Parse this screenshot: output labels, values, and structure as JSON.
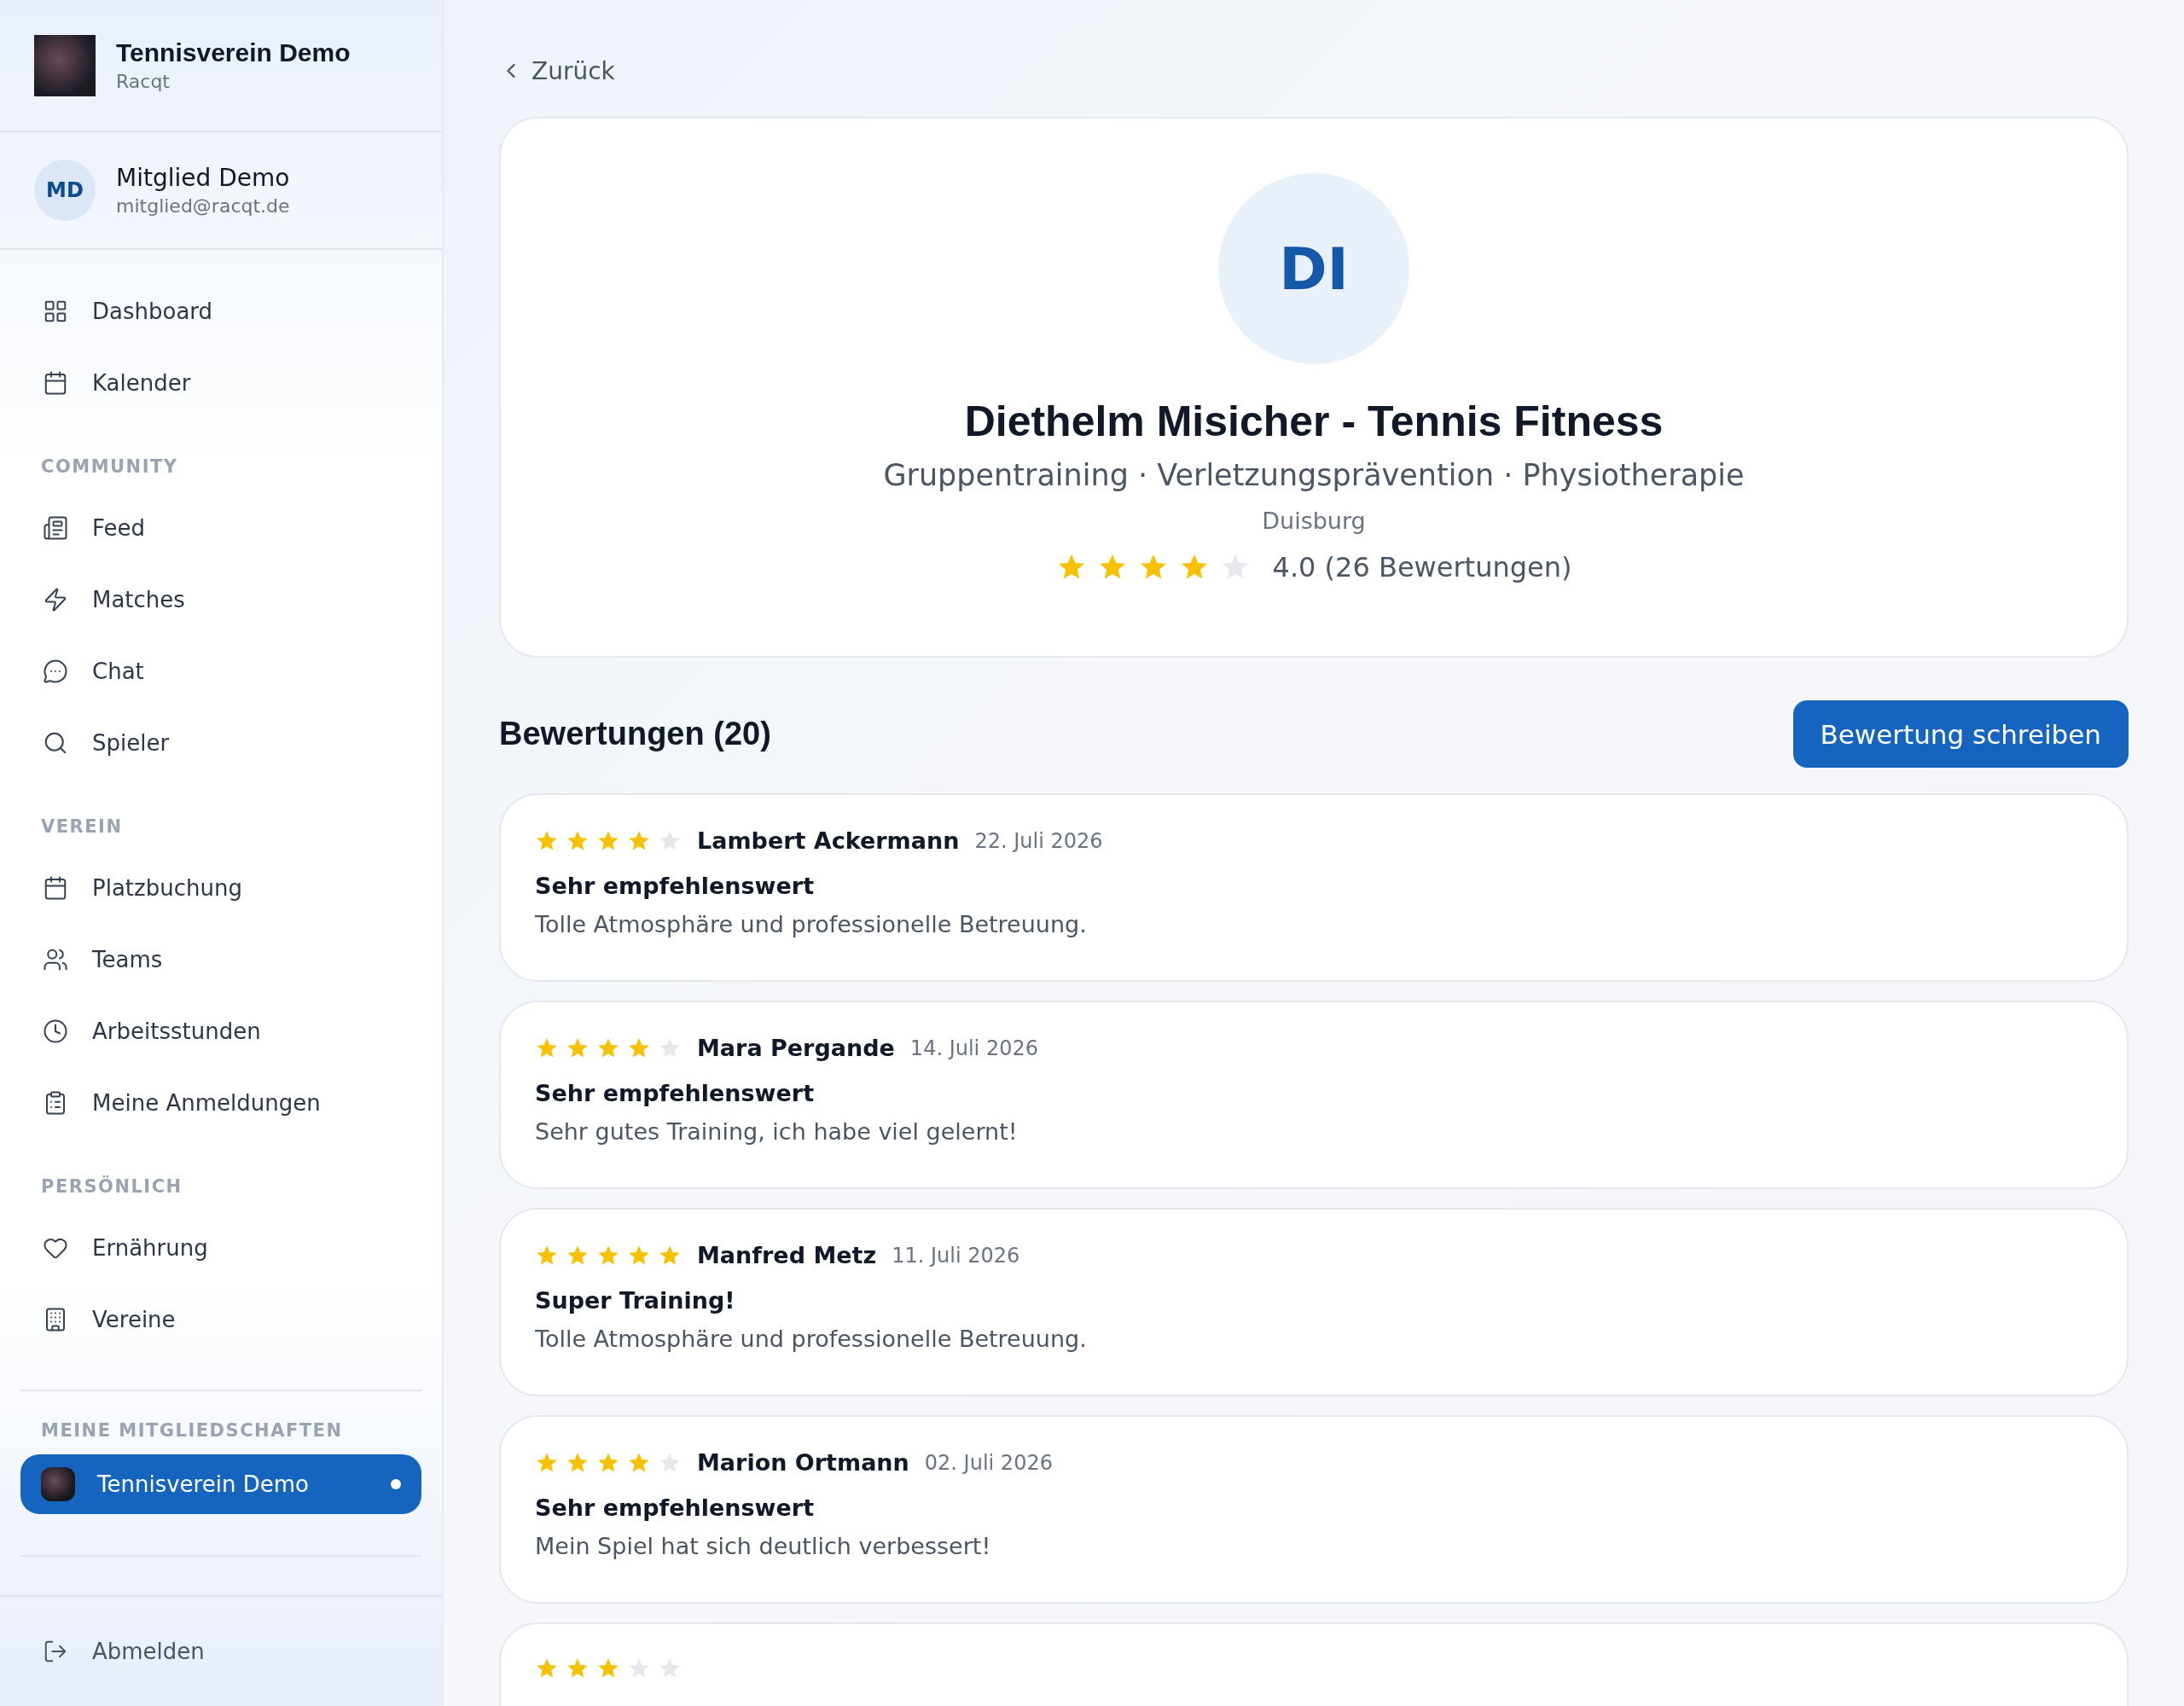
{
  "sidebar": {
    "club": {
      "name": "Tennisverein Demo",
      "subtitle": "Racqt"
    },
    "user": {
      "initials": "MD",
      "name": "Mitglied Demo",
      "email": "mitglied@racqt.de"
    },
    "sections": [
      {
        "items": [
          {
            "label": "Dashboard"
          },
          {
            "label": "Kalender"
          }
        ]
      },
      {
        "heading": "COMMUNITY",
        "items": [
          {
            "label": "Feed"
          },
          {
            "label": "Matches"
          },
          {
            "label": "Chat"
          },
          {
            "label": "Spieler"
          }
        ]
      },
      {
        "heading": "VEREIN",
        "items": [
          {
            "label": "Platzbuchung"
          },
          {
            "label": "Teams"
          },
          {
            "label": "Arbeitsstunden"
          },
          {
            "label": "Meine Anmeldungen"
          }
        ]
      },
      {
        "heading": "PERSÖNLICH",
        "items": [
          {
            "label": "Ernährung"
          },
          {
            "label": "Vereine"
          }
        ]
      }
    ],
    "memberships": {
      "heading": "MEINE MITGLIEDSCHAFTEN",
      "items": [
        {
          "name": "Tennisverein Demo",
          "selected": true
        }
      ]
    },
    "logout": "Abmelden"
  },
  "main": {
    "back": "Zurück",
    "profile": {
      "initials": "DI",
      "name": "Diethelm Misicher - Tennis Fitness",
      "specialties": "Gruppentraining · Verletzungsprävention · Physiotherapie",
      "city": "Duisburg",
      "stars": 4,
      "rating": "4.0 (26 Bewertungen)"
    },
    "reviews_heading": "Bewertungen (20)",
    "write_button": "Bewertung schreiben",
    "reviews": [
      {
        "stars": 4,
        "author": "Lambert Ackermann",
        "date": "22. Juli 2026",
        "title": "Sehr empfehlenswert",
        "text": "Tolle Atmosphäre und professionelle Betreuung."
      },
      {
        "stars": 4,
        "author": "Mara Pergande",
        "date": "14. Juli 2026",
        "title": "Sehr empfehlenswert",
        "text": "Sehr gutes Training, ich habe viel gelernt!"
      },
      {
        "stars": 5,
        "author": "Manfred Metz",
        "date": "11. Juli 2026",
        "title": "Super Training!",
        "text": "Tolle Atmosphäre und professionelle Betreuung."
      },
      {
        "stars": 4,
        "author": "Marion Ortmann",
        "date": "02. Juli 2026",
        "title": "Sehr empfehlenswert",
        "text": "Mein Spiel hat sich deutlich verbessert!"
      },
      {
        "stars": 3
      }
    ]
  }
}
